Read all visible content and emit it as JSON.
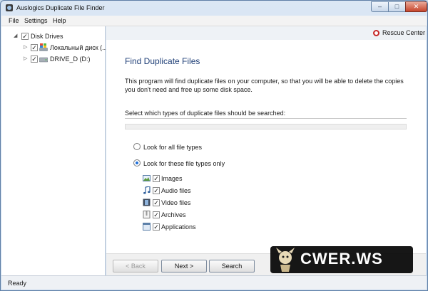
{
  "window": {
    "title": "Auslogics Duplicate File Finder",
    "controls": {
      "minimize": "–",
      "maximize": "□",
      "close": "✕"
    }
  },
  "menu": [
    "File",
    "Settings",
    "Help"
  ],
  "tree": {
    "root": {
      "label": "Disk Drives",
      "checked": true,
      "expander": "◢"
    },
    "drives": [
      {
        "label": "Локальный диск (...",
        "checked": true,
        "expander": "▷",
        "icon": "windows-drive-icon"
      },
      {
        "label": "DRIVE_D (D:)",
        "checked": true,
        "expander": "▷",
        "icon": "hard-drive-icon"
      }
    ]
  },
  "rescue_center": {
    "label": "Rescue Center",
    "icon": "lifebuoy-icon"
  },
  "main": {
    "heading": "Find Duplicate Files",
    "description": "This program will find duplicate files on your computer, so that you will be able to delete the copies you don't need and free up some disk space.",
    "select_label": "Select which types of duplicate files should be searched:",
    "options": [
      {
        "label": "Look for all file types",
        "selected": false
      },
      {
        "label": "Look for these file types only",
        "selected": true
      }
    ],
    "file_types": [
      {
        "label": "Images",
        "checked": true,
        "icon": "image-icon"
      },
      {
        "label": "Audio files",
        "checked": true,
        "icon": "music-note-icon"
      },
      {
        "label": "Video files",
        "checked": true,
        "icon": "film-icon"
      },
      {
        "label": "Archives",
        "checked": true,
        "icon": "archive-icon"
      },
      {
        "label": "Applications",
        "checked": true,
        "icon": "application-icon"
      }
    ]
  },
  "buttons": {
    "back": "< Back",
    "next": "Next >",
    "search": "Search"
  },
  "status": "Ready",
  "watermark": "CWER.WS",
  "colors": {
    "heading": "#1f3f77",
    "radio_selected": "#1e6fd9",
    "close_button": "#c6442b"
  }
}
